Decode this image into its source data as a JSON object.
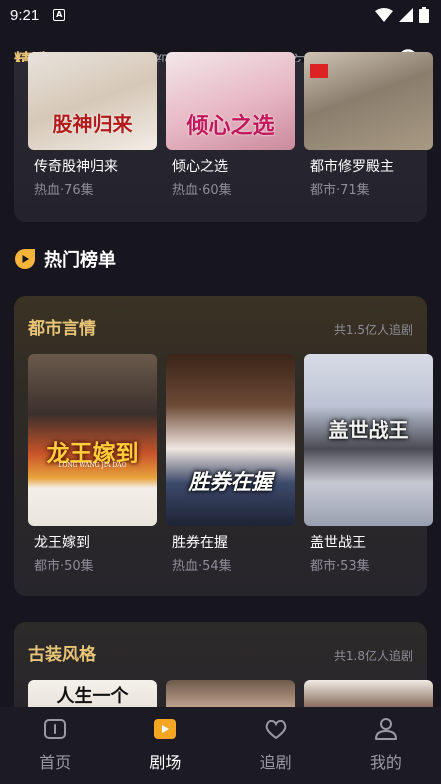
{
  "status_bar": {
    "time": "9:21",
    "app_icon_letter": "A"
  },
  "top_nav": {
    "tabs": [
      {
        "label": "精选"
      },
      {
        "label": "悬疑"
      },
      {
        "label": "都市"
      },
      {
        "label": "军事"
      },
      {
        "label": "玄幻"
      },
      {
        "label": "现"
      }
    ],
    "active_index": 0,
    "search_icon": "search-icon"
  },
  "top_card": {
    "shows": [
      {
        "name": "传奇股神归来",
        "sub": "热血·76集",
        "poster_title": "股神归来"
      },
      {
        "name": "倾心之选",
        "sub": "热血·60集",
        "poster_title": "倾心之选"
      },
      {
        "name": "都市修罗殿主",
        "sub": "都市·71集",
        "poster_title": ""
      }
    ]
  },
  "hot_section": {
    "title": "热门榜单",
    "icon": "play-icon"
  },
  "hot_card": {
    "title": "都市言情",
    "meta": "共1.5亿人追剧",
    "shows": [
      {
        "name": "龙王嫁到",
        "sub": "都市·50集",
        "poster_title": "龙王嫁到",
        "poster_subtitle": "LONG WANG JIA DAO"
      },
      {
        "name": "胜券在握",
        "sub": "热血·54集",
        "poster_title": "胜券在握",
        "poster_subtitle": ""
      },
      {
        "name": "盖世战王",
        "sub": "都市·53集",
        "poster_title": "盖世战王",
        "poster_subtitle": ""
      }
    ]
  },
  "costume_card": {
    "title": "古装风格",
    "meta": "共1.8亿人追剧",
    "shows": [
      {
        "poster_title": "人生一个"
      },
      {
        "poster_title": ""
      },
      {
        "poster_title": ""
      }
    ]
  },
  "bottom_nav": {
    "items": [
      {
        "label": "首页",
        "icon": "home-icon"
      },
      {
        "label": "剧场",
        "icon": "theater-icon"
      },
      {
        "label": "追剧",
        "icon": "heart-icon"
      },
      {
        "label": "我的",
        "icon": "profile-icon"
      }
    ],
    "active_index": 1
  },
  "colors": {
    "accent": "#e8c477",
    "background": "#17161f",
    "muted": "#8e8c97",
    "active_play": "#f5a623"
  }
}
